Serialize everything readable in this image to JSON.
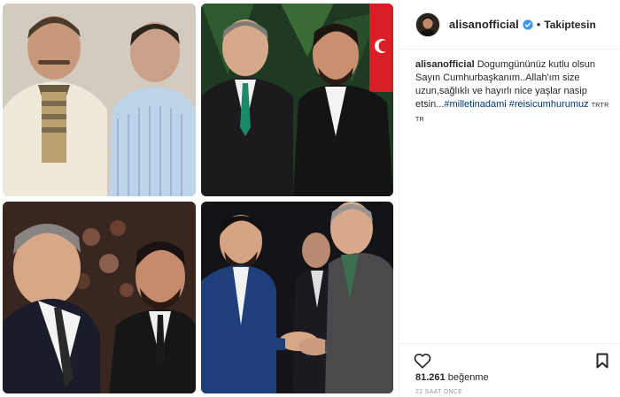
{
  "post": {
    "username": "alisanofficial",
    "follow_status": "Takiptesin",
    "separator": "•",
    "caption": {
      "username": "alisanofficial",
      "text": " Dogumgününüz kutlu olsun Sayın Cumhurbaşkanım..Allah'ım size uzun,sağlıklı ve hayırlı nice yaşlar nasip etsin...",
      "hashtag1": "#milletinadami",
      "hashtag2": "#reisicumhurumuz",
      "tags": "TRTR TR"
    },
    "likes_count": "81.261",
    "likes_word": "beğenme",
    "timestamp": "22 SAAT ÖNCE"
  },
  "icons": {
    "verified": "verified-badge-icon",
    "heart": "heart-icon",
    "bookmark": "bookmark-icon"
  },
  "colors": {
    "verified_blue": "#3897f0",
    "hashtag": "#003569",
    "border": "#efefef"
  }
}
